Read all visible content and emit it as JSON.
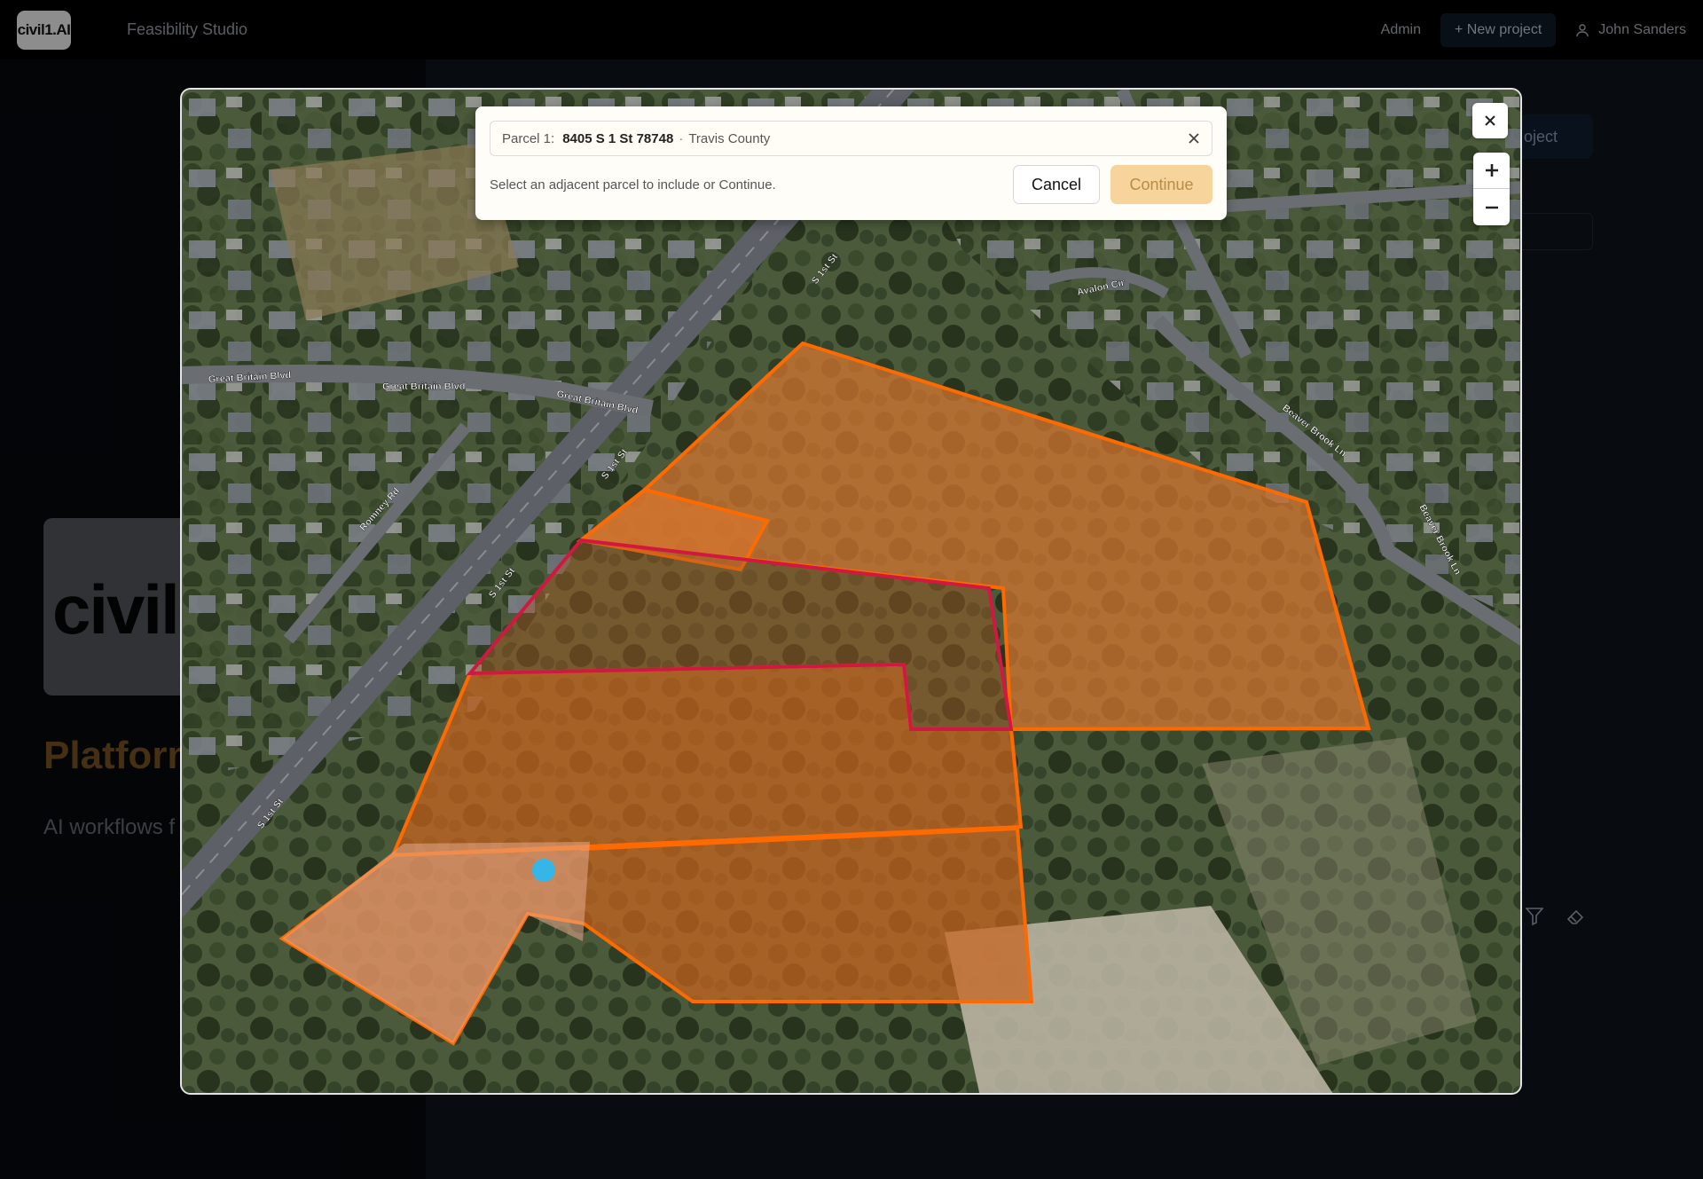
{
  "app": {
    "logo_text": "civil1.AI",
    "studio_name": "Feasibility Studio"
  },
  "topbar": {
    "admin_label": "Admin",
    "new_project_label": "+ New project",
    "user_name": "John Sanders"
  },
  "background": {
    "hero_text": "civil",
    "platform_title": "Platform",
    "platform_subtitle": "AI workflows f",
    "project_button_label": "oject"
  },
  "parcel_dialog": {
    "parcel_prefix": "Parcel 1:",
    "parcel_address": "8405 S 1 St 78748",
    "separator": "·",
    "county": "Travis County",
    "hint": "Select an adjacent parcel to include or Continue.",
    "cancel_label": "Cancel",
    "continue_label": "Continue"
  },
  "map": {
    "zoom_in_label": "+",
    "zoom_out_label": "−",
    "street_labels": {
      "great_britain_1": "Great Britain Blvd",
      "great_britain_2": "Great Britain Blvd",
      "great_britain_3": "Great Britain Blvd",
      "s1st_a": "S 1st St",
      "s1st_b": "S 1st St",
      "s1st_c": "S 1st St",
      "s1st_d": "S 1st St",
      "romney": "Romney Rd",
      "avalon": "Avalon Cir",
      "beaver_brook_1": "Beaver Brook Ln",
      "beaver_brook_2": "Beaver Brook Ln"
    },
    "colors": {
      "parcel_stroke": "#ff6a00",
      "selected_parcel_stroke": "#d01840",
      "parcel_fill": "#d8762f"
    }
  }
}
